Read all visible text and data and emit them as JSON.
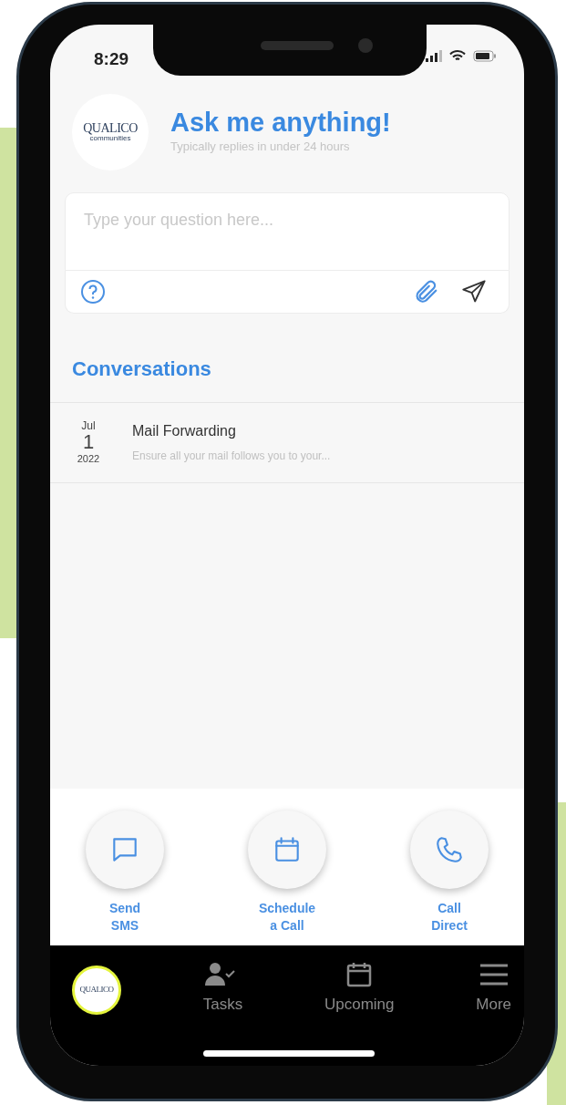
{
  "status_bar": {
    "time": "8:29"
  },
  "header": {
    "logo": {
      "name": "QUALICO",
      "tagline": "communities"
    },
    "title": "Ask me anything!",
    "subtitle": "Typically replies in under 24 hours"
  },
  "composer": {
    "placeholder": "Type your question here..."
  },
  "conversations": {
    "heading": "Conversations",
    "items": [
      {
        "month": "Jul",
        "day": "1",
        "year": "2022",
        "title": "Mail Forwarding",
        "preview": "Ensure all your mail follows you to your..."
      }
    ]
  },
  "actions": [
    {
      "kind": "sms",
      "label": "Send\nSMS"
    },
    {
      "kind": "schedule",
      "label": "Schedule\na Call"
    },
    {
      "kind": "call",
      "label": "Call\nDirect"
    }
  ],
  "tab_bar": [
    {
      "kind": "logo",
      "label": "QUALICO"
    },
    {
      "kind": "tasks",
      "label": "Tasks"
    },
    {
      "kind": "upcoming",
      "label": "Upcoming"
    },
    {
      "kind": "more",
      "label": "More"
    }
  ]
}
